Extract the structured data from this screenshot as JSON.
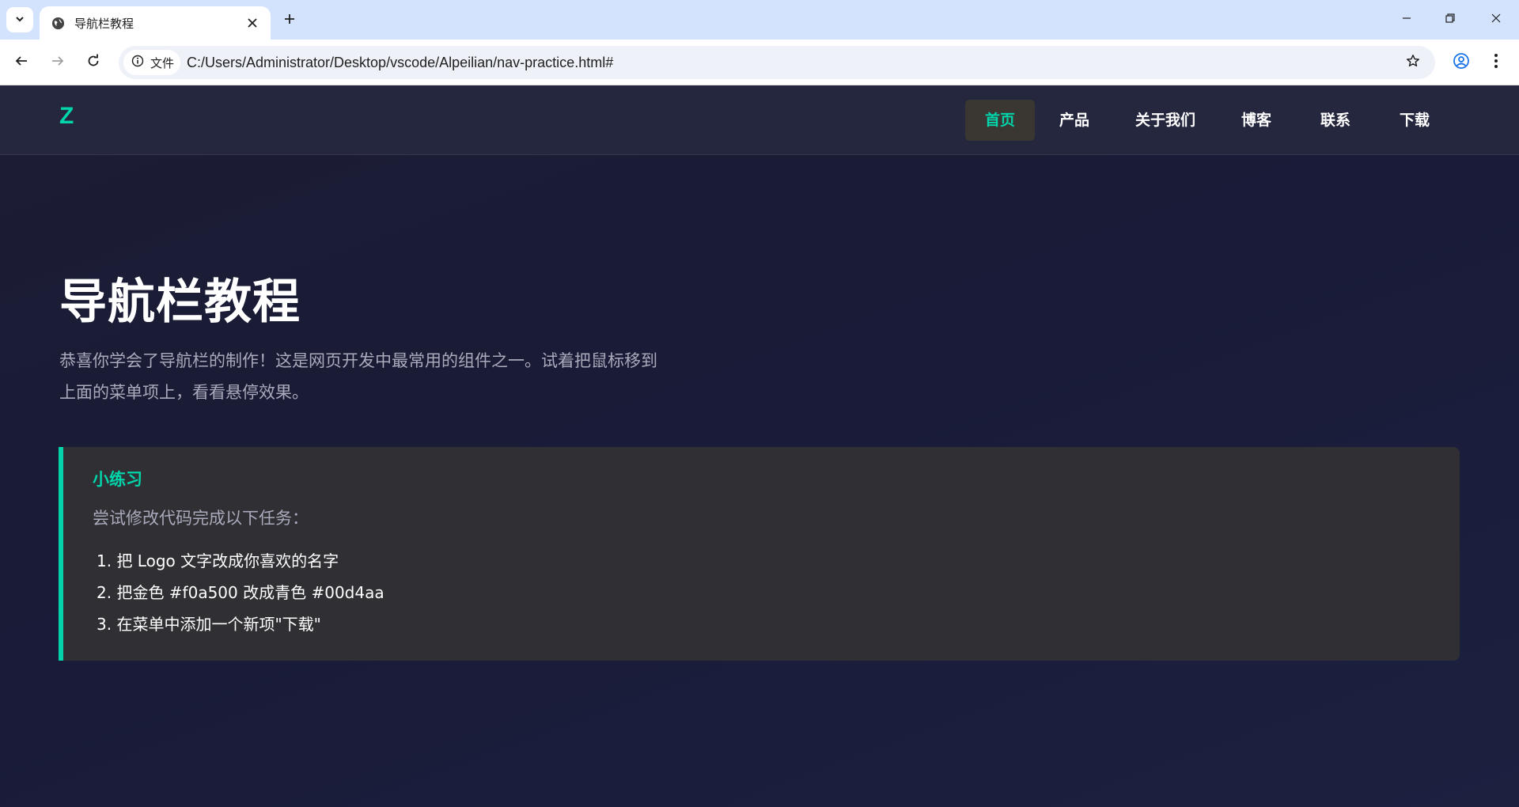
{
  "browser": {
    "tab_title": "导航栏教程",
    "url": "C:/Users/Administrator/Desktop/vscode/Alpeilian/nav-practice.html#",
    "site_info_label": "文件"
  },
  "site": {
    "logo": "Z",
    "nav": [
      {
        "label": "首页",
        "active": true
      },
      {
        "label": "产品",
        "active": false
      },
      {
        "label": "关于我们",
        "active": false
      },
      {
        "label": "博客",
        "active": false
      },
      {
        "label": "联系",
        "active": false
      },
      {
        "label": "下载",
        "active": false
      }
    ],
    "accent_color": "#00d4aa"
  },
  "hero": {
    "title": "导航栏教程",
    "description": "恭喜你学会了导航栏的制作！这是网页开发中最常用的组件之一。试着把鼠标移到上面的菜单项上，看看悬停效果。"
  },
  "exercise": {
    "title": "小练习",
    "intro": "尝试修改代码完成以下任务：",
    "tasks": [
      "1. 把 Logo 文字改成你喜欢的名字",
      "2. 把金色 #f0a500 改成青色 #00d4aa",
      "3. 在菜单中添加一个新项\"下载\""
    ]
  }
}
